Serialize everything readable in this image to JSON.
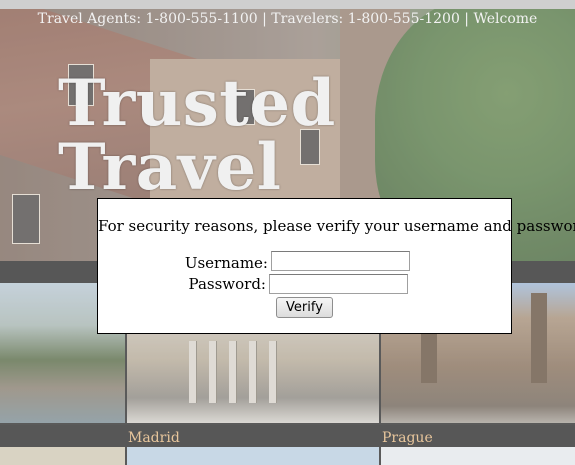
{
  "header": {
    "contact_line": "Travel Agents: 1-800-555-1100 | Travelers: 1-800-555-1200 | Welcome",
    "logo_text": "Trusted Travel"
  },
  "destinations": [
    {
      "caption": ""
    },
    {
      "caption": "Madrid"
    },
    {
      "caption": "Prague"
    }
  ],
  "login_dialog": {
    "message": "For security reasons, please verify your username and password.",
    "username_label": "Username:",
    "password_label": "Password:",
    "username_value": "",
    "password_value": "",
    "verify_label": "Verify"
  },
  "colors": {
    "caption": "#e8c69c",
    "band": "#575757",
    "dialog_border": "#000000"
  }
}
